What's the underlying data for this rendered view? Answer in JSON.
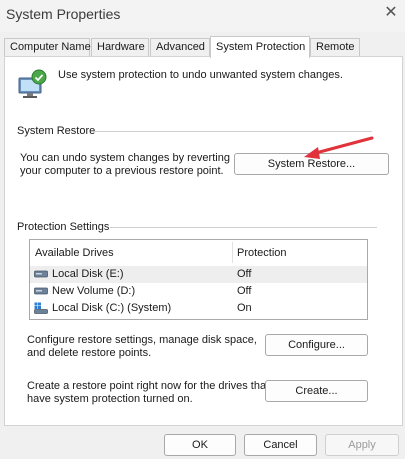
{
  "window": {
    "title": "System Properties",
    "close_glyph": "✕"
  },
  "tabs": [
    {
      "label": "Computer Name",
      "active": false
    },
    {
      "label": "Hardware",
      "active": false
    },
    {
      "label": "Advanced",
      "active": false
    },
    {
      "label": "System Protection",
      "active": true
    },
    {
      "label": "Remote",
      "active": false
    }
  ],
  "intro": {
    "text": "Use system protection to undo unwanted system changes."
  },
  "system_restore": {
    "heading": "System Restore",
    "description_line1": "You can undo system changes by reverting",
    "description_line2": "your computer to a previous restore point.",
    "button": "System Restore..."
  },
  "protection": {
    "heading": "Protection Settings",
    "columns": [
      "Available Drives",
      "Protection"
    ],
    "drives": [
      {
        "name": "Local Disk (E:)",
        "protection": "Off",
        "selected": true,
        "icon": "drive-icon"
      },
      {
        "name": "New Volume (D:)",
        "protection": "Off",
        "selected": false,
        "icon": "drive-icon"
      },
      {
        "name": "Local Disk (C:) (System)",
        "protection": "On",
        "selected": false,
        "icon": "system-drive-icon"
      }
    ],
    "configure_line1": "Configure restore settings, manage disk space,",
    "configure_line2": "and delete restore points.",
    "configure_button": "Configure...",
    "create_line1": "Create a restore point right now for the drives that",
    "create_line2": "have system protection turned on.",
    "create_button": "Create..."
  },
  "footer": {
    "ok": "OK",
    "cancel": "Cancel",
    "apply": "Apply"
  },
  "colors": {
    "annotation_arrow": "#e0333c",
    "tab_border": "#c9c9c9"
  }
}
